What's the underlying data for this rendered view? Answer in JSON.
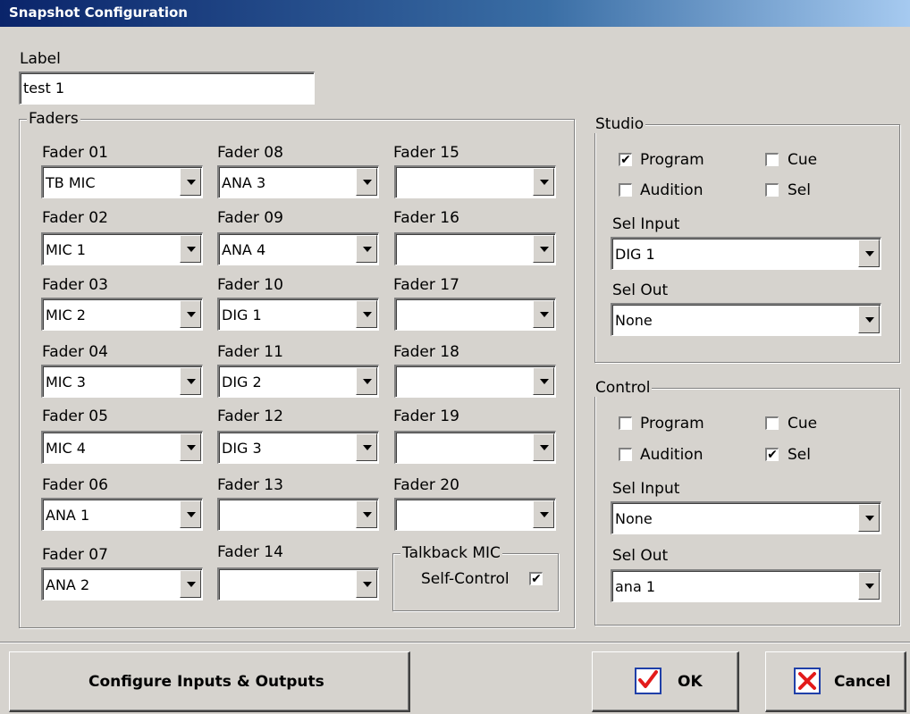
{
  "window": {
    "title": "Snapshot Configuration"
  },
  "label": {
    "caption": "Label",
    "value": "test 1"
  },
  "faders": {
    "title": "Faders",
    "items": [
      {
        "label": "Fader 01",
        "value": "TB MIC"
      },
      {
        "label": "Fader 02",
        "value": "MIC 1"
      },
      {
        "label": "Fader 03",
        "value": "MIC 2"
      },
      {
        "label": "Fader 04",
        "value": "MIC 3"
      },
      {
        "label": "Fader 05",
        "value": "MIC 4"
      },
      {
        "label": "Fader 06",
        "value": "ANA 1"
      },
      {
        "label": "Fader 07",
        "value": "ANA 2"
      },
      {
        "label": "Fader 08",
        "value": "ANA 3"
      },
      {
        "label": "Fader 09",
        "value": "ANA 4"
      },
      {
        "label": "Fader 10",
        "value": "DIG 1"
      },
      {
        "label": "Fader 11",
        "value": "DIG 2"
      },
      {
        "label": "Fader 12",
        "value": "DIG 3"
      },
      {
        "label": "Fader 13",
        "value": ""
      },
      {
        "label": "Fader 14",
        "value": ""
      },
      {
        "label": "Fader 15",
        "value": ""
      },
      {
        "label": "Fader 16",
        "value": ""
      },
      {
        "label": "Fader 17",
        "value": ""
      },
      {
        "label": "Fader 18",
        "value": ""
      },
      {
        "label": "Fader 19",
        "value": ""
      },
      {
        "label": "Fader 20",
        "value": ""
      }
    ],
    "talkback": {
      "title": "Talkback MIC",
      "self_control_label": "Self-Control",
      "self_control_checked": true
    }
  },
  "studio": {
    "title": "Studio",
    "program": {
      "label": "Program",
      "checked": true
    },
    "cue": {
      "label": "Cue",
      "checked": false
    },
    "audition": {
      "label": "Audition",
      "checked": false
    },
    "sel": {
      "label": "Sel",
      "checked": false
    },
    "sel_input": {
      "label": "Sel Input",
      "value": "DIG 1"
    },
    "sel_out": {
      "label": "Sel Out",
      "value": "None"
    }
  },
  "control": {
    "title": "Control",
    "program": {
      "label": "Program",
      "checked": false
    },
    "cue": {
      "label": "Cue",
      "checked": false
    },
    "audition": {
      "label": "Audition",
      "checked": false
    },
    "sel": {
      "label": "Sel",
      "checked": true
    },
    "sel_input": {
      "label": "Sel Input",
      "value": "None"
    },
    "sel_out": {
      "label": "Sel Out",
      "value": "ana 1"
    }
  },
  "buttons": {
    "configure": "Configure Inputs & Outputs",
    "ok": "OK",
    "cancel": "Cancel"
  },
  "glyphs": {
    "check": "✔"
  },
  "colors": {
    "titlebar_start": "#0a246a",
    "ok_check": "#1f3fa8",
    "cancel_x": "#e31b1b"
  },
  "icons": {
    "ok": "blue-check-icon",
    "cancel": "red-x-icon"
  }
}
